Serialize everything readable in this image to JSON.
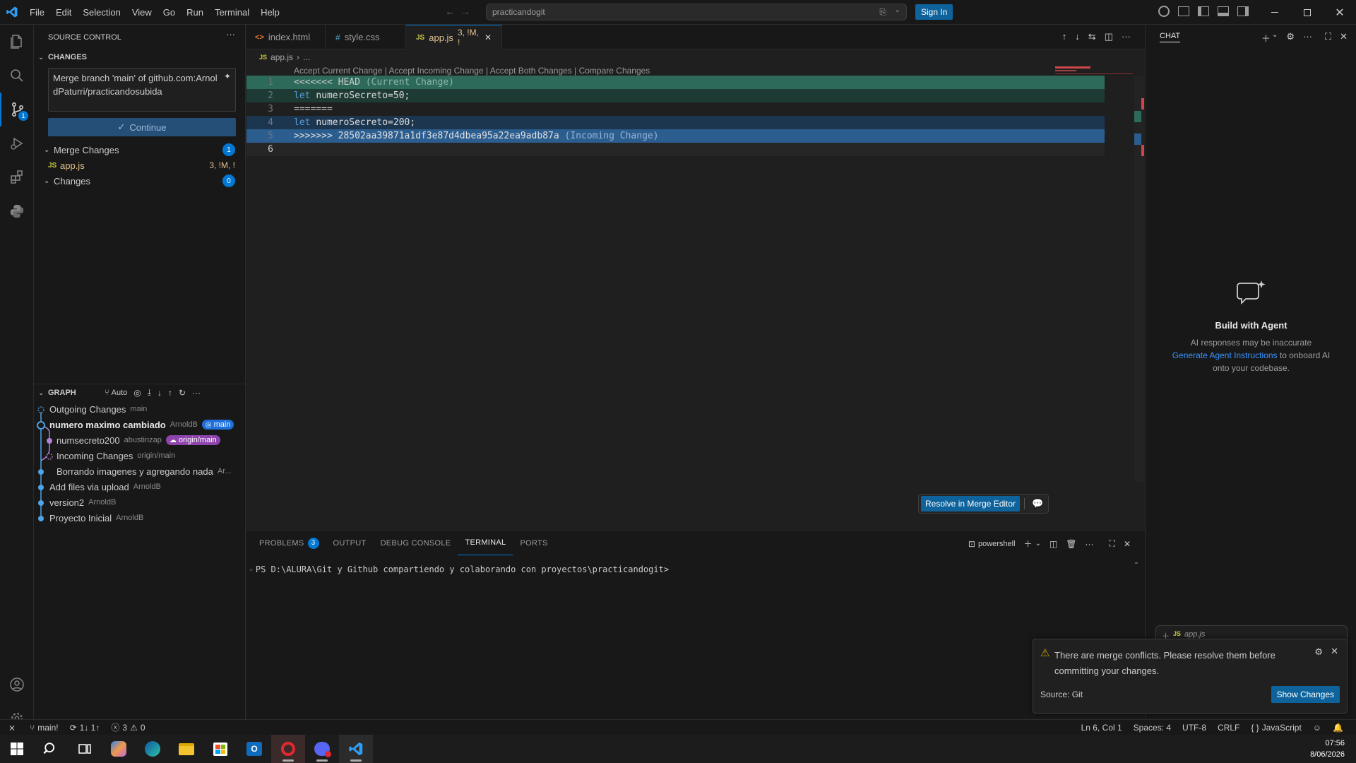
{
  "titlebar": {
    "menu": [
      "File",
      "Edit",
      "Selection",
      "View",
      "Go",
      "Run",
      "Terminal",
      "Help"
    ],
    "search": "practicandogit",
    "sign_in": "Sign In"
  },
  "activity": {
    "scm_badge": "1"
  },
  "source_control": {
    "title": "SOURCE CONTROL",
    "changes_header": "CHANGES",
    "commit_message": "Merge branch 'main' of github.com:ArnoldPaturri/practicandosubida",
    "continue_label": "Continue",
    "merge_changes_label": "Merge Changes",
    "merge_changes_count": "1",
    "merge_file": {
      "name": "app.js",
      "status": "3, !M, !"
    },
    "changes_label": "Changes",
    "changes_count": "0"
  },
  "graph": {
    "title": "GRAPH",
    "auto_label": "Auto",
    "rows": [
      {
        "label": "Outgoing Changes",
        "meta": "main"
      },
      {
        "label": "numero maximo cambiado",
        "meta": "ArnoldB",
        "pill": "main"
      },
      {
        "label": "numsecreto200",
        "meta": "abustinzap",
        "pill": "origin/main"
      },
      {
        "label": "Incoming Changes",
        "meta": "origin/main"
      },
      {
        "label": "Borrando imagenes y agregando nada",
        "meta": "Ar..."
      },
      {
        "label": "Add files via upload",
        "meta": "ArnoldB"
      },
      {
        "label": "version2",
        "meta": "ArnoldB"
      },
      {
        "label": "Proyecto Inicial",
        "meta": "ArnoldB"
      }
    ]
  },
  "tabs": [
    {
      "name": "index.html",
      "icon": "<>"
    },
    {
      "name": "style.css",
      "icon": "#"
    },
    {
      "name": "app.js",
      "icon": "JS",
      "status": "3, !M, !"
    }
  ],
  "breadcrumb": {
    "file": "app.js",
    "rest": "..."
  },
  "codelens": "Accept Current Change | Accept Incoming Change | Accept Both Changes | Compare Changes",
  "code": {
    "line_numbers": [
      "1",
      "2",
      "3",
      "4",
      "5",
      "6"
    ],
    "l1_marker": "<<<<<<< HEAD",
    "l1_note": "(Current Change)",
    "l2_kw": "let",
    "l2_rest": "numeroSecreto=50;",
    "l3": "=======",
    "l4_kw": "let",
    "l4_rest": "numeroSecreto=200;",
    "l5_marker": ">>>>>>> 28502aa39871a1df3e87d4dbea95a22ea9adb87a",
    "l5_note": "(Incoming Change)"
  },
  "resolve_button": "Resolve in Merge Editor",
  "panel": {
    "tabs": [
      "PROBLEMS",
      "OUTPUT",
      "DEBUG CONSOLE",
      "TERMINAL",
      "PORTS"
    ],
    "problems_count": "3",
    "shell": "powershell",
    "prompt": "PS D:\\ALURA\\Git y Github compartiendo y  colaborando con proyectos\\practicandogit>"
  },
  "chat": {
    "title": "CHAT",
    "heading": "Build with Agent",
    "line1": "AI responses may be inaccurate",
    "link": "Generate Agent Instructions",
    "line2_rest": "to onboard AI",
    "line3": "onto your codebase.",
    "attachment": "app.js"
  },
  "notification": {
    "message": "There are merge conflicts. Please resolve them before committing your changes.",
    "source": "Source: Git",
    "button": "Show Changes"
  },
  "status": {
    "branch": "main!",
    "sync": "1↓ 1↑",
    "errors": "3",
    "warnings": "0",
    "position": "Ln 6, Col 1",
    "spaces": "Spaces: 4",
    "encoding": "UTF-8",
    "eol": "CRLF",
    "language": "JavaScript"
  },
  "clock": {
    "time": "07:56",
    "date": "8/06/2026"
  }
}
